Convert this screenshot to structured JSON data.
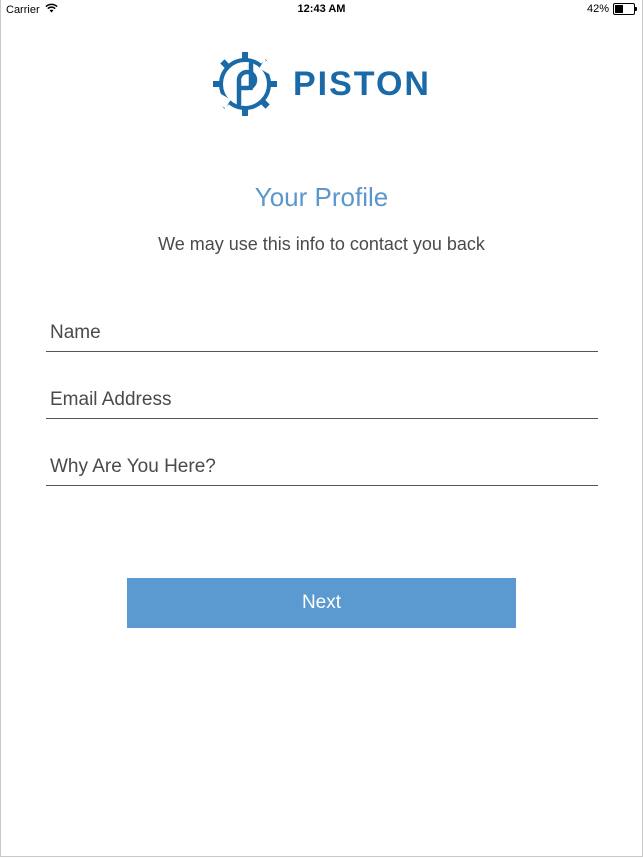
{
  "status_bar": {
    "carrier": "Carrier",
    "time": "12:43 AM",
    "battery_text": "42%",
    "battery_level": 0.42,
    "wifi_icon": "wifi-icon"
  },
  "logo": {
    "text": "PISTON",
    "icon": "piston-gear-icon",
    "color": "#1a6aa8"
  },
  "profile": {
    "title": "Your Profile",
    "subtitle": "We may use this info to contact you back",
    "title_color": "#5b97cc"
  },
  "form": {
    "name_placeholder": "Name",
    "name_value": "",
    "email_placeholder": "Email Address",
    "email_value": "",
    "why_placeholder": "Why Are You Here?",
    "why_value": ""
  },
  "actions": {
    "next_label": "Next",
    "button_color": "#5b9ad1"
  }
}
